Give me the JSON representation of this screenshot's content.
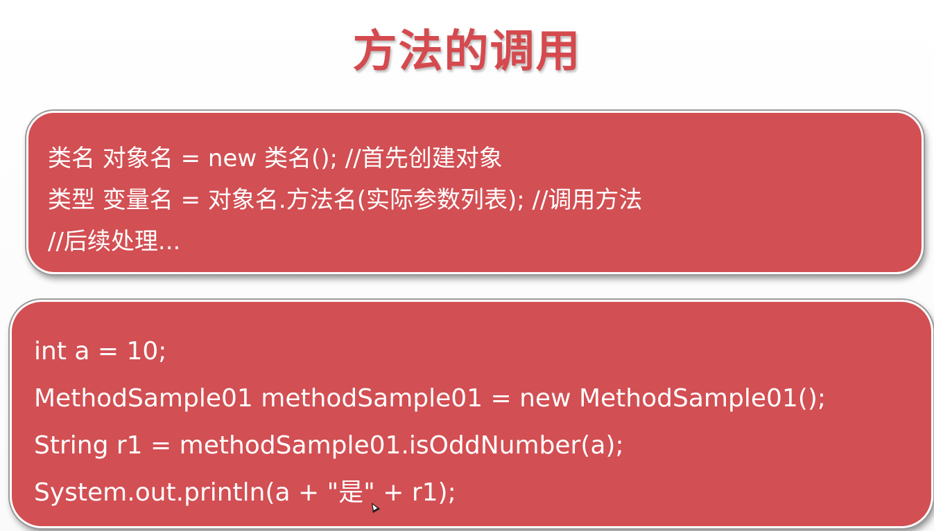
{
  "title": "方法的调用",
  "syntax_box": {
    "lines": [
      "类名 对象名 = new 类名(); //首先创建对象",
      "类型 变量名 = 对象名.方法名(实际参数列表); //调用方法",
      "//后续处理..."
    ]
  },
  "example_box": {
    "lines": [
      "int a = 10;",
      "MethodSample01 methodSample01 = new MethodSample01();",
      "String r1 = methodSample01.isOddNumber(a);",
      "System.out.println(a + \"是\" + r1);"
    ]
  },
  "colors": {
    "title": "#d44a4e",
    "box_fill": "#d24f53",
    "box_text": "#ffffff"
  }
}
